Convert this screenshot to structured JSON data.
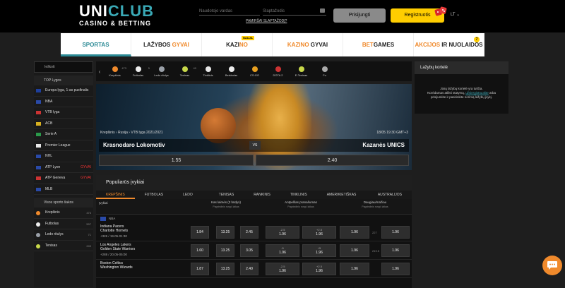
{
  "logo": {
    "top": "UNI",
    "top_accent": "CLUB",
    "bottom": "CASINO & BETTING"
  },
  "login": {
    "username_placeholder": "Naudotojo vardas",
    "password_placeholder": "Slaptažodis",
    "forgot": "PAMIRŠAI SLAPTAŽODĮ?",
    "login_label": "Prisijungti",
    "register_label": "Registruotis",
    "lang": "LT"
  },
  "nav": {
    "items": [
      {
        "label": "SPORTAS",
        "active": true
      },
      {
        "label_a": "LAŽYBOS ",
        "label_b": "GYVAI"
      },
      {
        "label_a": "KAZI",
        "label_b": "NO",
        "badge": "NAUJA"
      },
      {
        "label_a": "KAZINO ",
        "label_b": "GYVAI"
      },
      {
        "label_a": "BET",
        "label_b": "GAMES"
      },
      {
        "label_a": "AKCIJOS ",
        "label_b": "IR NUOLAIDOS",
        "num": "7"
      }
    ]
  },
  "sidebar": {
    "search": "Ieškoti",
    "top_title": "TOP Lygos",
    "top": [
      {
        "label": "Europa lyga, 1-as pusfinalis",
        "flag": "#1e3f9c"
      },
      {
        "label": "NBA",
        "flag": "#2a4aa8"
      },
      {
        "label": "VTB lyga",
        "flag": "#cc3333"
      },
      {
        "label": "ACB",
        "flag": "#d8b020"
      },
      {
        "label": "Serie A",
        "flag": "#2a9a4a"
      },
      {
        "label": "Premier League",
        "flag": "#e8e8e8"
      },
      {
        "label": "NHL",
        "flag": "#2a4aa8"
      },
      {
        "label": "ATP Lyon",
        "flag": "#2a4aa8",
        "live": "GYVAI"
      },
      {
        "label": "ATP Geneva",
        "flag": "#cc3333",
        "live": "GYVAI"
      },
      {
        "label": "MLB",
        "flag": "#2a4aa8"
      }
    ],
    "all_title": "Visos sporto šakos",
    "all": [
      {
        "label": "Krepšinis",
        "count": "473",
        "color": "#f08a2c"
      },
      {
        "label": "Futbolas",
        "count": "597",
        "color": "#eeeeee"
      },
      {
        "label": "Ledo ritulys",
        "count": "71",
        "color": "#9aa0a8"
      },
      {
        "label": "Tenisas",
        "count": "240",
        "color": "#c8d84a"
      }
    ]
  },
  "sports_bar": [
    {
      "label": "Krepšinis",
      "count": "473",
      "color": "#f08a2c"
    },
    {
      "label": "Futbolas",
      "count": "5",
      "color": "#eeeeee"
    },
    {
      "label": "Ledo ritulys",
      "count": "",
      "color": "#9aa0a8"
    },
    {
      "label": "Tenisas",
      "count": "40",
      "color": "#c8d84a"
    },
    {
      "label": "Tinklinis",
      "count": "",
      "color": "#e8e8e8"
    },
    {
      "label": "Beisbolas",
      "count": "",
      "color": "#eeeeee"
    },
    {
      "label": "CS:GO",
      "count": "",
      "color": "#e8a020"
    },
    {
      "label": "DOTA 2",
      "count": "",
      "color": "#cc3333"
    },
    {
      "label": "E-Tenisas",
      "count": "",
      "color": "#c8d84a"
    },
    {
      "label": "Fu",
      "count": "",
      "color": "#aaaaaa"
    }
  ],
  "banner": {
    "crumb": "Krepšinis › Rusija › VTB lyga 2021/2021",
    "time": "18/05 19:30 GMT+3",
    "home": "Krasnodaro Lokomotiv",
    "away": "Kazanės UNICS",
    "vs": "VS",
    "odd_home": "1.55",
    "odd_away": "2.40"
  },
  "popular": {
    "title": "Populiarūs įvykiai",
    "tabs": [
      "KREPŠINIS",
      "FUTBOLAS",
      "LEDO RITULYS",
      "TENISAS",
      "RANKINIS",
      "TINKLINIS",
      "AMERIKIETIŠKAS FUTBOLAS",
      "AUSTRALIJOS"
    ],
    "col_event": "Įvykiai",
    "col1": "Kas laimės (3 būdys)",
    "col1_sub": "Pagrindinis rungt. laikas",
    "col2": "Antpelšas pranašumas",
    "col2_sub": "Pagrindinis rungt. laikas",
    "col3": "Daugiau/mažiau",
    "col3_sub": "Pagrindinis rungt. laikas",
    "league": "NBA",
    "matches": [
      {
        "teams": "Indiana Pacers",
        "teams2": "Charlotte Hornets",
        "meta": "+326 / 19.05-01:30",
        "w1": "1.84",
        "x": "13.25",
        "w2": "2.45",
        "h1": "-2.5",
        "h1v": "1.96",
        "h2": "+2.5",
        "h2v": "1.96",
        "o": "1.96",
        "line": "227",
        "u": "1.96"
      },
      {
        "teams": "Los Angeles Lakers",
        "teams2": "Golden State Warriors",
        "meta": "+288 / 20.05-05:00",
        "w1": "1.60",
        "x": "13.25",
        "w2": "3.05",
        "h1": "-5",
        "h1v": "1.96",
        "h2": "+5",
        "h2v": "1.96",
        "o": "1.96",
        "line": "219.5",
        "u": "1.96"
      },
      {
        "teams": "Boston Celtics",
        "teams2": "Washington Wizards",
        "meta": "",
        "w1": "1.87",
        "x": "13.25",
        "w2": "2.40",
        "h1": "-2.5",
        "h1v": "1.96",
        "h2": "+2.5",
        "h2v": "1.96",
        "o": "1.96",
        "line": "",
        "u": "1.96"
      }
    ]
  },
  "slip": {
    "title": "Lažybų kortelė",
    "msg1": "Jūsų lažybų kortelė yra tuščia.",
    "msg2a": "Norėdamas atlikti statymą, ",
    "msg2link": "užsiregistruokite",
    "msg2b": " arba",
    "msg3": "prisijunkite ir pasirinkite norimą lažybų įvykį."
  }
}
